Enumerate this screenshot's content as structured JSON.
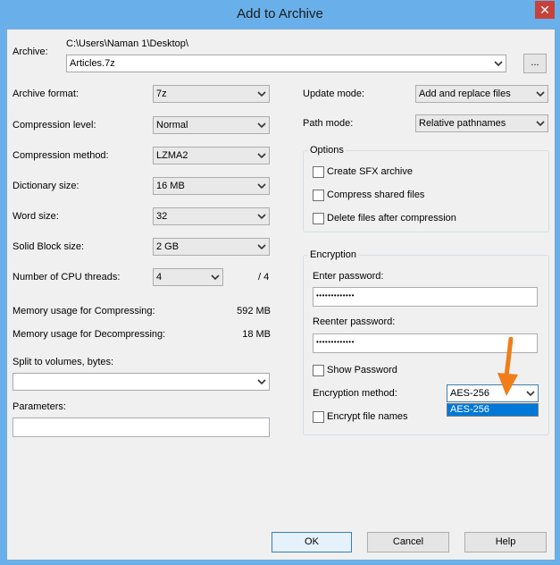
{
  "window": {
    "title": "Add to Archive",
    "close_glyph": "✕"
  },
  "archive": {
    "label": "Archive:",
    "path": "C:\\Users\\Naman 1\\Desktop\\",
    "filename": "Articles.7z",
    "browse_label": "..."
  },
  "left": {
    "archive_format": {
      "label": "Archive format:",
      "value": "7z"
    },
    "compression_level": {
      "label": "Compression level:",
      "value": "Normal"
    },
    "compression_method": {
      "label": "Compression method:",
      "value": "LZMA2"
    },
    "dictionary_size": {
      "label": "Dictionary size:",
      "value": "16 MB"
    },
    "word_size": {
      "label": "Word size:",
      "value": "32"
    },
    "solid_block": {
      "label": "Solid Block size:",
      "value": "2 GB"
    },
    "cpu_threads": {
      "label": "Number of CPU threads:",
      "value": "4",
      "total": "/ 4"
    },
    "mem_compress": {
      "label": "Memory usage for Compressing:",
      "value": "592 MB"
    },
    "mem_decompress": {
      "label": "Memory usage for Decompressing:",
      "value": "18 MB"
    },
    "split": {
      "label": "Split to volumes, bytes:",
      "value": ""
    },
    "parameters": {
      "label": "Parameters:",
      "value": ""
    }
  },
  "right": {
    "update_mode": {
      "label": "Update mode:",
      "value": "Add and replace files"
    },
    "path_mode": {
      "label": "Path mode:",
      "value": "Relative pathnames"
    },
    "options": {
      "title": "Options",
      "create_sfx": "Create SFX archive",
      "compress_shared": "Compress shared files",
      "delete_after": "Delete files after compression"
    },
    "encryption": {
      "title": "Encryption",
      "enter_password_label": "Enter password:",
      "enter_password_value": "•••••••••••••",
      "reenter_password_label": "Reenter password:",
      "reenter_password_value": "•••••••••••••",
      "show_password": "Show Password",
      "method_label": "Encryption method:",
      "method_value": "AES-256",
      "method_options": [
        "AES-256"
      ],
      "encrypt_names": "Encrypt file names"
    }
  },
  "buttons": {
    "ok": "OK",
    "cancel": "Cancel",
    "help": "Help"
  },
  "colors": {
    "accent": "#f07d1a",
    "selection": "#0078d7",
    "titlebar": "#69b0ea"
  }
}
